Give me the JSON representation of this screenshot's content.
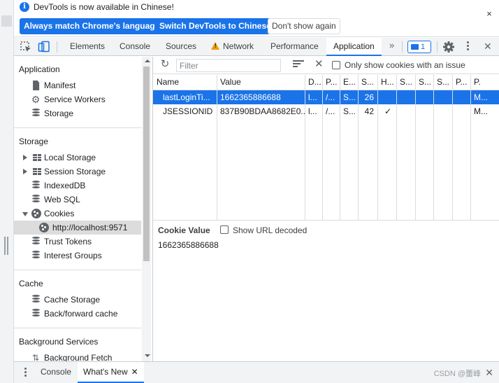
{
  "infobar": {
    "message": "DevTools is now available in Chinese!",
    "btn_match": "Always match Chrome's language",
    "btn_switch": "Switch DevTools to Chinese",
    "btn_dismiss": "Don't show again",
    "close_glyph": "×"
  },
  "toolbar": {
    "tabs": [
      "Elements",
      "Console",
      "Sources",
      "Network",
      "Performance",
      "Application"
    ],
    "active_tab": "Application",
    "more_glyph": "»",
    "issues_count": "1",
    "close_glyph": "✕"
  },
  "sidebar": {
    "application": {
      "title": "Application",
      "items": [
        "Manifest",
        "Service Workers",
        "Storage"
      ]
    },
    "storage": {
      "title": "Storage",
      "items": [
        "Local Storage",
        "Session Storage",
        "IndexedDB",
        "Web SQL",
        "Cookies",
        "http://localhost:9571",
        "Trust Tokens",
        "Interest Groups"
      ]
    },
    "cache": {
      "title": "Cache",
      "items": [
        "Cache Storage",
        "Back/forward cache"
      ]
    },
    "background": {
      "title": "Background Services",
      "items": [
        "Background Fetch"
      ]
    }
  },
  "cookies": {
    "filter_placeholder": "Filter",
    "only_issues_label": "Only show cookies with an issue",
    "columns": [
      "Name",
      "Value",
      "D...",
      "P...",
      "E...",
      "S...",
      "H...",
      "S...",
      "S...",
      "S...",
      "P...",
      "P."
    ],
    "rows": [
      [
        "lastLoginTi...",
        "1662365886688",
        "l...",
        "/...",
        "S...",
        "26",
        "",
        "",
        "",
        "",
        "",
        "M..."
      ],
      [
        "JSESSIONID",
        "837B90BDAA8682E0...",
        "l...",
        "/...",
        "S...",
        "42",
        "✓",
        "",
        "",
        "",
        "",
        "M..."
      ]
    ],
    "selected_row": 0
  },
  "detail": {
    "title": "Cookie Value",
    "show_decoded_label": "Show URL decoded",
    "value": "1662365886688"
  },
  "drawer": {
    "tabs": [
      "Console",
      "What's New"
    ],
    "active_tab": "What's New",
    "tab_close_glyph": "✕",
    "watermark": "CSDN @蕾峰",
    "close_glyph": "✕"
  },
  "colors": {
    "accent": "#1a73e8",
    "toolbar_bg": "#f1f3f4",
    "warning": "#f29900"
  }
}
